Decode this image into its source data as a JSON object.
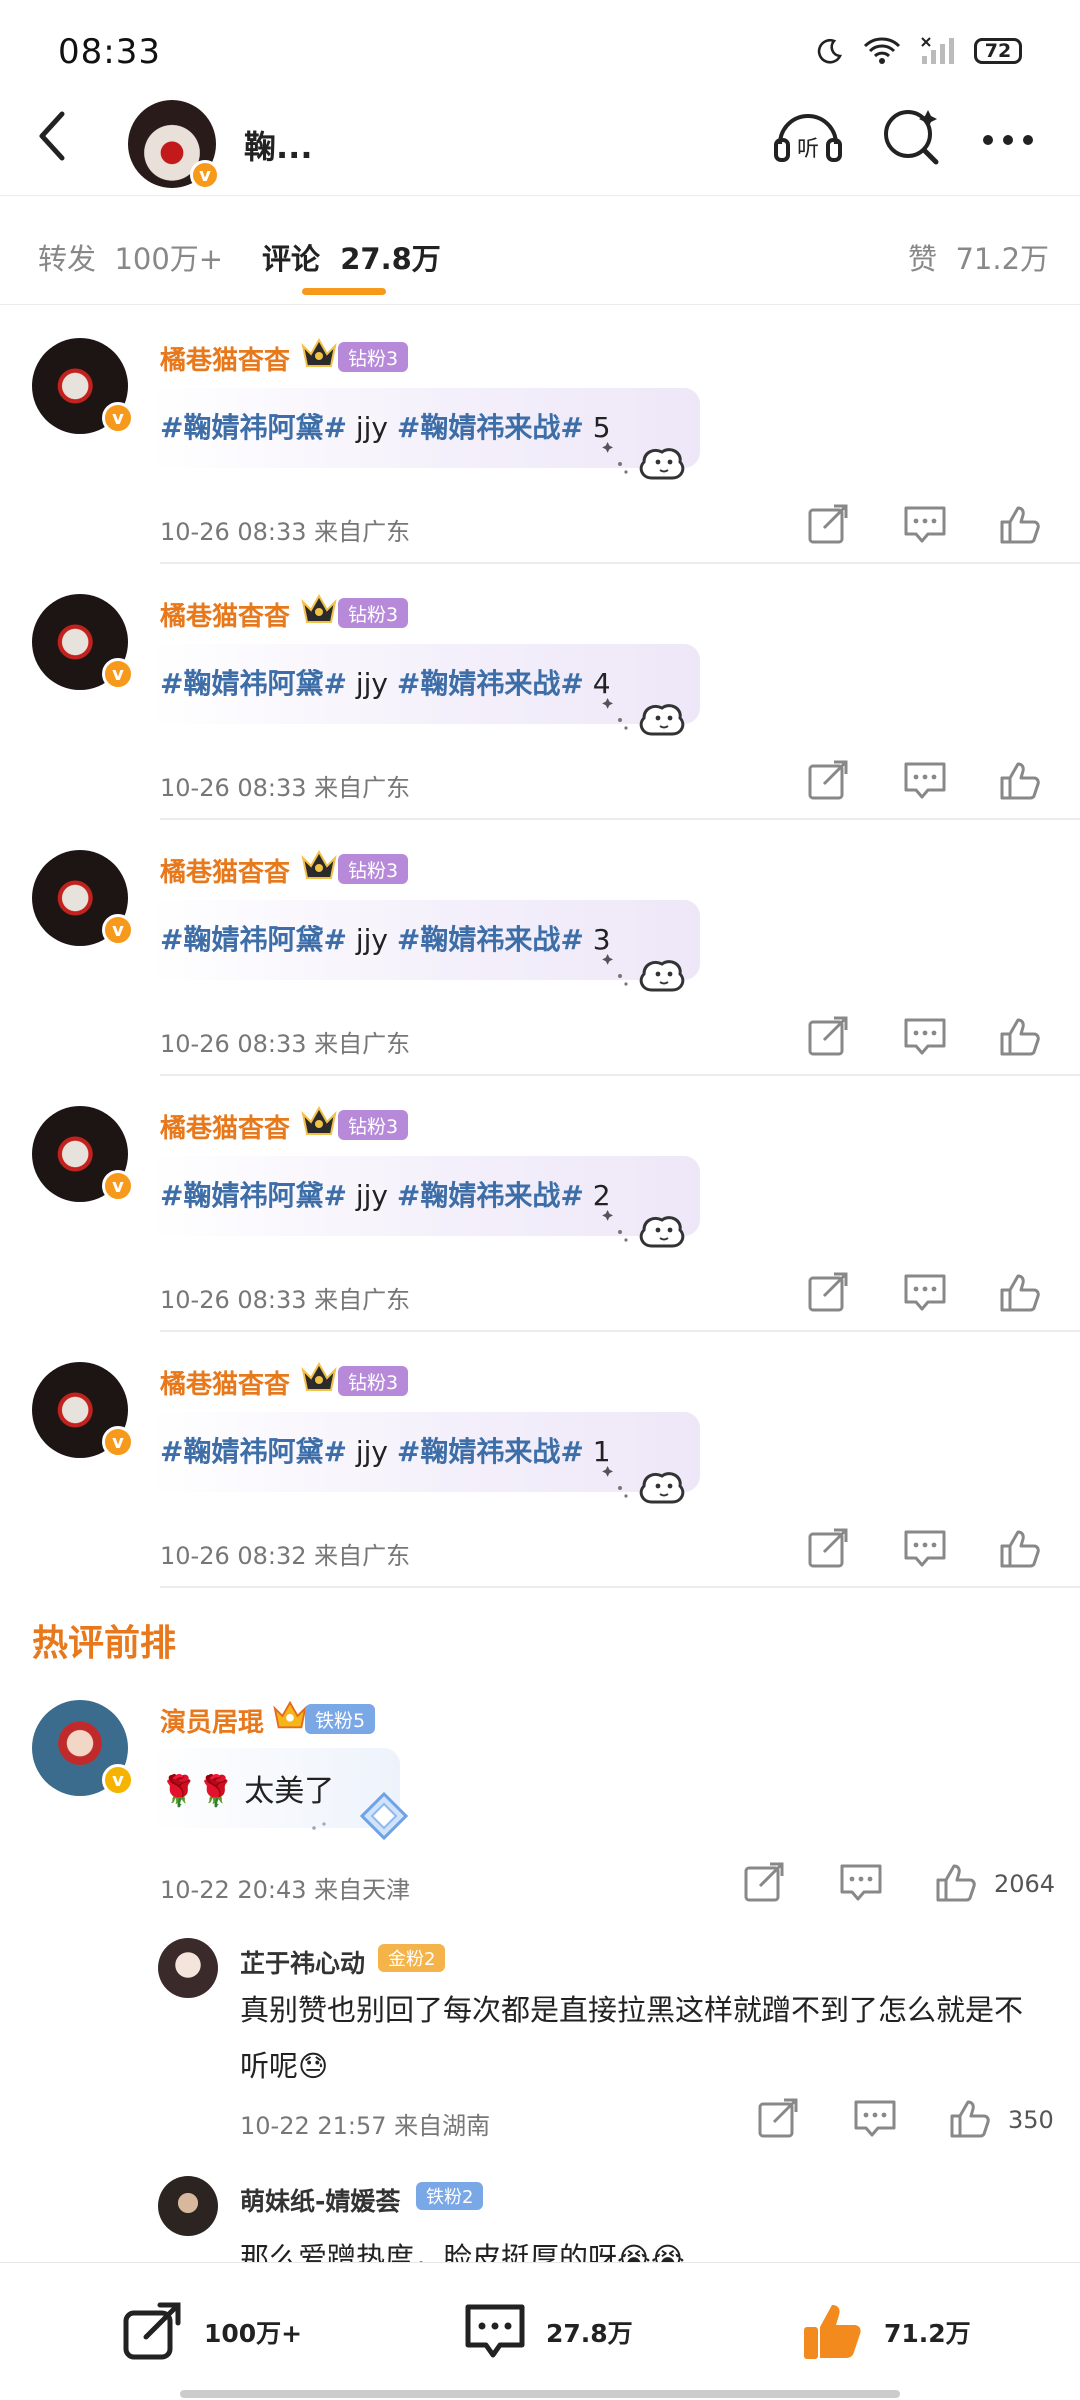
{
  "status_bar": {
    "time": "08:33",
    "battery": "72"
  },
  "header": {
    "author_name": "鞠..."
  },
  "tabs": {
    "repost_label": "转发",
    "repost_count": "100万+",
    "comment_label": "评论",
    "comment_count": "27.8万",
    "like_label": "赞",
    "like_count": "71.2万"
  },
  "comments": [
    {
      "name": "橘巷猫杳杳",
      "fan_badge": "钻粉3",
      "topic1": "#鞠婧祎阿黛#",
      "mid": "jjy",
      "topic2": "#鞠婧祎来战#",
      "num": "5",
      "meta": "10-26  08:33  来自广东"
    },
    {
      "name": "橘巷猫杳杳",
      "fan_badge": "钻粉3",
      "topic1": "#鞠婧祎阿黛#",
      "mid": "jjy",
      "topic2": "#鞠婧祎来战#",
      "num": "4",
      "meta": "10-26  08:33  来自广东"
    },
    {
      "name": "橘巷猫杳杳",
      "fan_badge": "钻粉3",
      "topic1": "#鞠婧祎阿黛#",
      "mid": "jjy",
      "topic2": "#鞠婧祎来战#",
      "num": "3",
      "meta": "10-26  08:33  来自广东"
    },
    {
      "name": "橘巷猫杳杳",
      "fan_badge": "钻粉3",
      "topic1": "#鞠婧祎阿黛#",
      "mid": "jjy",
      "topic2": "#鞠婧祎来战#",
      "num": "2",
      "meta": "10-26  08:33  来自广东"
    },
    {
      "name": "橘巷猫杳杳",
      "fan_badge": "钻粉3",
      "topic1": "#鞠婧祎阿黛#",
      "mid": "jjy",
      "topic2": "#鞠婧祎来战#",
      "num": "1",
      "meta": "10-26  08:32  来自广东"
    }
  ],
  "hot_section": {
    "title": "热评前排",
    "top": {
      "name": "演员居琨",
      "fan_badge": "铁粉5",
      "emoji": "🌹🌹",
      "text": "太美了",
      "meta": "10-22  20:43  来自天津",
      "likes": "2064"
    },
    "replies": [
      {
        "name": "芷于祎心动",
        "fan_badge": "金粉2",
        "text": "真别赞也别回了每次都是直接拉黑这样就蹭不到了怎么就是不听呢😓",
        "meta": "10-22  21:57  来自湖南",
        "likes": "350"
      },
      {
        "name": "萌妹纸-婧媛荟",
        "fan_badge": "铁粉2",
        "text": "那么爱蹭热度，脸皮挺厚的呀😭😭"
      }
    ]
  },
  "bottom_bar": {
    "repost": "100万+",
    "comment": "27.8万",
    "like": "71.2万"
  },
  "colors": {
    "accent": "#f79a1b",
    "name_orange": "#e8781c",
    "topic_blue": "#3e6ea8",
    "like_orange": "#f28a1e"
  }
}
